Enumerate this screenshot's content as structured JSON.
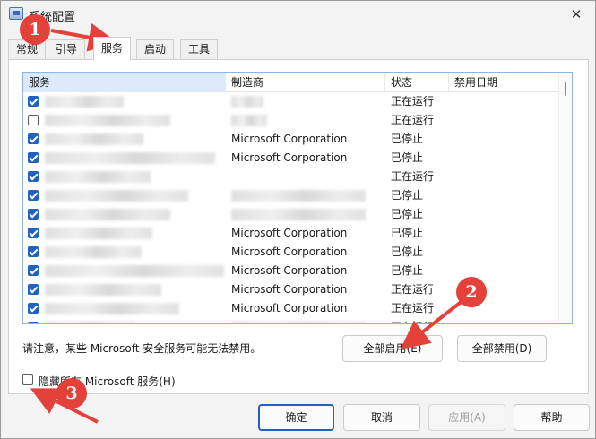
{
  "window": {
    "title": "系统配置",
    "close_glyph": "✕"
  },
  "tabs": [
    {
      "label": "常规",
      "active": false
    },
    {
      "label": "引导",
      "active": false
    },
    {
      "label": "服务",
      "active": true
    },
    {
      "label": "启动",
      "active": false
    },
    {
      "label": "工具",
      "active": false
    }
  ],
  "columns": {
    "service": "服务",
    "manufacturer": "制造商",
    "status": "状态",
    "disable_date": "禁用日期"
  },
  "rows": [
    {
      "checked": true,
      "manufacturer": "",
      "status": "正在运行"
    },
    {
      "checked": false,
      "manufacturer": "",
      "status": "正在运行"
    },
    {
      "checked": true,
      "manufacturer": "Microsoft Corporation",
      "status": "已停止"
    },
    {
      "checked": true,
      "manufacturer": "Microsoft Corporation",
      "status": "已停止"
    },
    {
      "checked": true,
      "manufacturer": "",
      "status": "正在运行"
    },
    {
      "checked": true,
      "manufacturer": "",
      "status": "已停止"
    },
    {
      "checked": true,
      "manufacturer": "",
      "status": "已停止"
    },
    {
      "checked": true,
      "manufacturer": "Microsoft Corporation",
      "status": "已停止"
    },
    {
      "checked": true,
      "manufacturer": "Microsoft Corporation",
      "status": "已停止"
    },
    {
      "checked": true,
      "manufacturer": "Microsoft Corporation",
      "status": "已停止"
    },
    {
      "checked": true,
      "manufacturer": "Microsoft Corporation",
      "status": "正在运行"
    },
    {
      "checked": true,
      "manufacturer": "Microsoft Corporation",
      "status": "正在运行"
    },
    {
      "checked": true,
      "manufacturer": "",
      "status": "正在运行"
    }
  ],
  "note": "请注意，某些 Microsoft 安全服务可能无法禁用。",
  "buttons": {
    "enable_all": "全部启用(E)",
    "disable_all": "全部禁用(D)",
    "ok": "确定",
    "cancel": "取消",
    "apply": "应用(A)",
    "help": "帮助"
  },
  "hide_ms": {
    "label": "隐藏所有 Microsoft 服务(H)",
    "checked": false
  },
  "annotations": [
    "1",
    "2",
    "3"
  ],
  "colors": {
    "annotation": "#e5413b",
    "accent": "#1f62c4"
  }
}
